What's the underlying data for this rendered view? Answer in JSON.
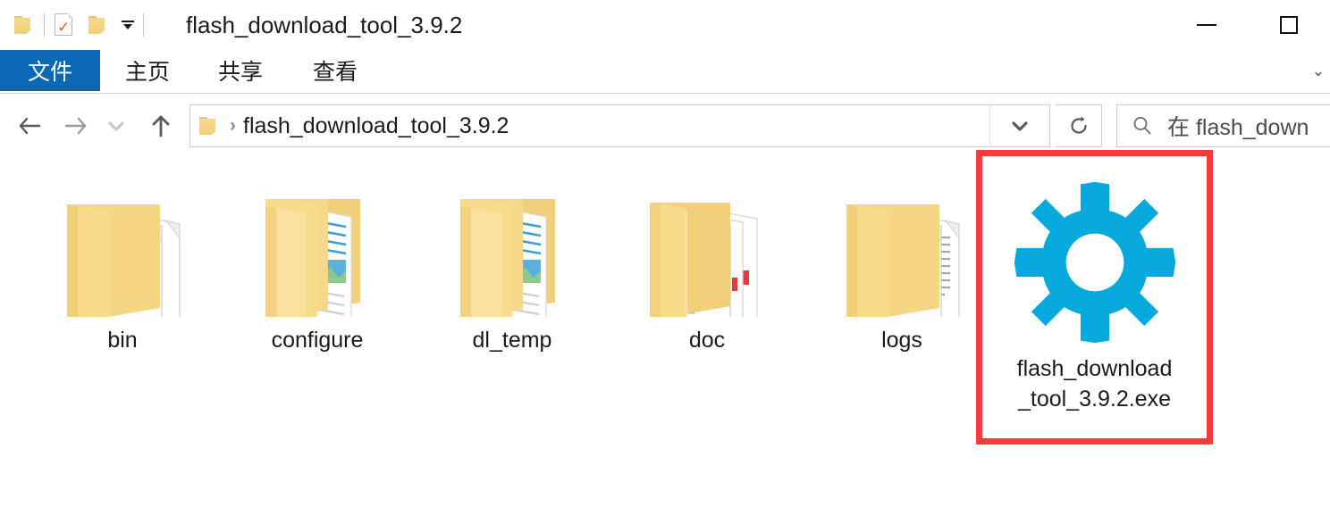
{
  "window": {
    "title": "flash_download_tool_3.9.2",
    "controls": {
      "minimize_label": "",
      "maximize_label": "",
      "minimize_name": "minimize",
      "maximize_name": "maximize"
    }
  },
  "quick_access": {
    "items": [
      {
        "name": "explorer-icon",
        "label": ""
      },
      {
        "name": "properties-icon",
        "label": ""
      },
      {
        "name": "new-folder-icon",
        "label": ""
      },
      {
        "name": "customize-dropdown",
        "label": "▾"
      }
    ]
  },
  "ribbon": {
    "tabs": [
      {
        "id": "file",
        "label": "文件",
        "active": true
      },
      {
        "id": "home",
        "label": "主页",
        "active": false
      },
      {
        "id": "share",
        "label": "共享",
        "active": false
      },
      {
        "id": "view",
        "label": "查看",
        "active": false
      }
    ],
    "expand_caret": "⌄",
    "active_tab_color": "#0a68b4"
  },
  "navigation": {
    "back": "←",
    "forward": "→",
    "recent": "⌄",
    "up": "↑"
  },
  "address_bar": {
    "separator": "›",
    "path": "flash_download_tool_3.9.2",
    "dropdown_caret": "⌄"
  },
  "refresh": {
    "glyph": "↻"
  },
  "search": {
    "icon": "search-icon",
    "placeholder": "在 flash_down"
  },
  "files": [
    {
      "name": "bin",
      "type": "folder-documents",
      "label": "bin"
    },
    {
      "name": "configure",
      "type": "folder-subfolders",
      "label": "configure"
    },
    {
      "name": "dl_temp",
      "type": "folder-subfolders",
      "label": "dl_temp"
    },
    {
      "name": "doc",
      "type": "folder-pdfs",
      "label": "doc"
    },
    {
      "name": "logs",
      "type": "folder-textdocs",
      "label": "logs"
    }
  ],
  "selected_file": {
    "name": "flash_download_tool_3.9.2.exe",
    "label": "flash_download\n_tool_3.9.2.exe",
    "icon": "gear-icon",
    "icon_color": "#06a9dc",
    "highlight_color": "#f93a3a"
  },
  "colors": {
    "folder_yellow": "#f8dc8c",
    "folder_yellow_dark": "#e8c36a",
    "ribbon_blue": "#0a68b4",
    "gear_cyan": "#06a9dc",
    "annotation_red": "#f93a3a",
    "text": "#1b1b1b"
  }
}
